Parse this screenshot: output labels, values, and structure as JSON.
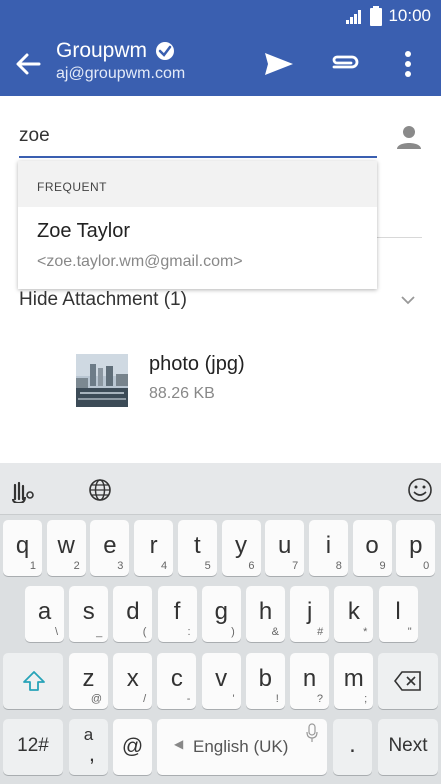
{
  "status": {
    "time": "10:00"
  },
  "header": {
    "account_name": "Groupwm",
    "account_email": "aj@groupwm.com"
  },
  "compose": {
    "to_value": "zoe"
  },
  "suggestion": {
    "header": "FREQUENT",
    "name": "Zoe Taylor",
    "email": "<zoe.taylor.wm@gmail.com>"
  },
  "attachments": {
    "toggle_label": "Hide Attachment (1)",
    "file_name": "photo (jpg)",
    "file_size": "88.26 KB"
  },
  "keyboard": {
    "row1": [
      {
        "k": "q",
        "s": "1"
      },
      {
        "k": "w",
        "s": "2"
      },
      {
        "k": "e",
        "s": "3"
      },
      {
        "k": "r",
        "s": "4"
      },
      {
        "k": "t",
        "s": "5"
      },
      {
        "k": "y",
        "s": "6"
      },
      {
        "k": "u",
        "s": "7"
      },
      {
        "k": "i",
        "s": "8"
      },
      {
        "k": "o",
        "s": "9"
      },
      {
        "k": "p",
        "s": "0"
      }
    ],
    "row2": [
      {
        "k": "a",
        "s": "\\"
      },
      {
        "k": "s",
        "s": "_"
      },
      {
        "k": "d",
        "s": "("
      },
      {
        "k": "f",
        "s": ":"
      },
      {
        "k": "g",
        "s": ")"
      },
      {
        "k": "h",
        "s": "&"
      },
      {
        "k": "j",
        "s": "#"
      },
      {
        "k": "k",
        "s": "*"
      },
      {
        "k": "l",
        "s": "\""
      }
    ],
    "row3": [
      {
        "k": "z",
        "s": "@"
      },
      {
        "k": "x",
        "s": "/"
      },
      {
        "k": "c",
        "s": "-"
      },
      {
        "k": "v",
        "s": "'"
      },
      {
        "k": "b",
        "s": "!"
      },
      {
        "k": "n",
        "s": "?"
      },
      {
        "k": "m",
        "s": ";"
      }
    ],
    "symbols_label": "12#",
    "comma_main": "a",
    "comma_sub": ",",
    "at_label": "@",
    "space_label": "English (UK)",
    "period_label": ".",
    "next_label": "Next"
  }
}
